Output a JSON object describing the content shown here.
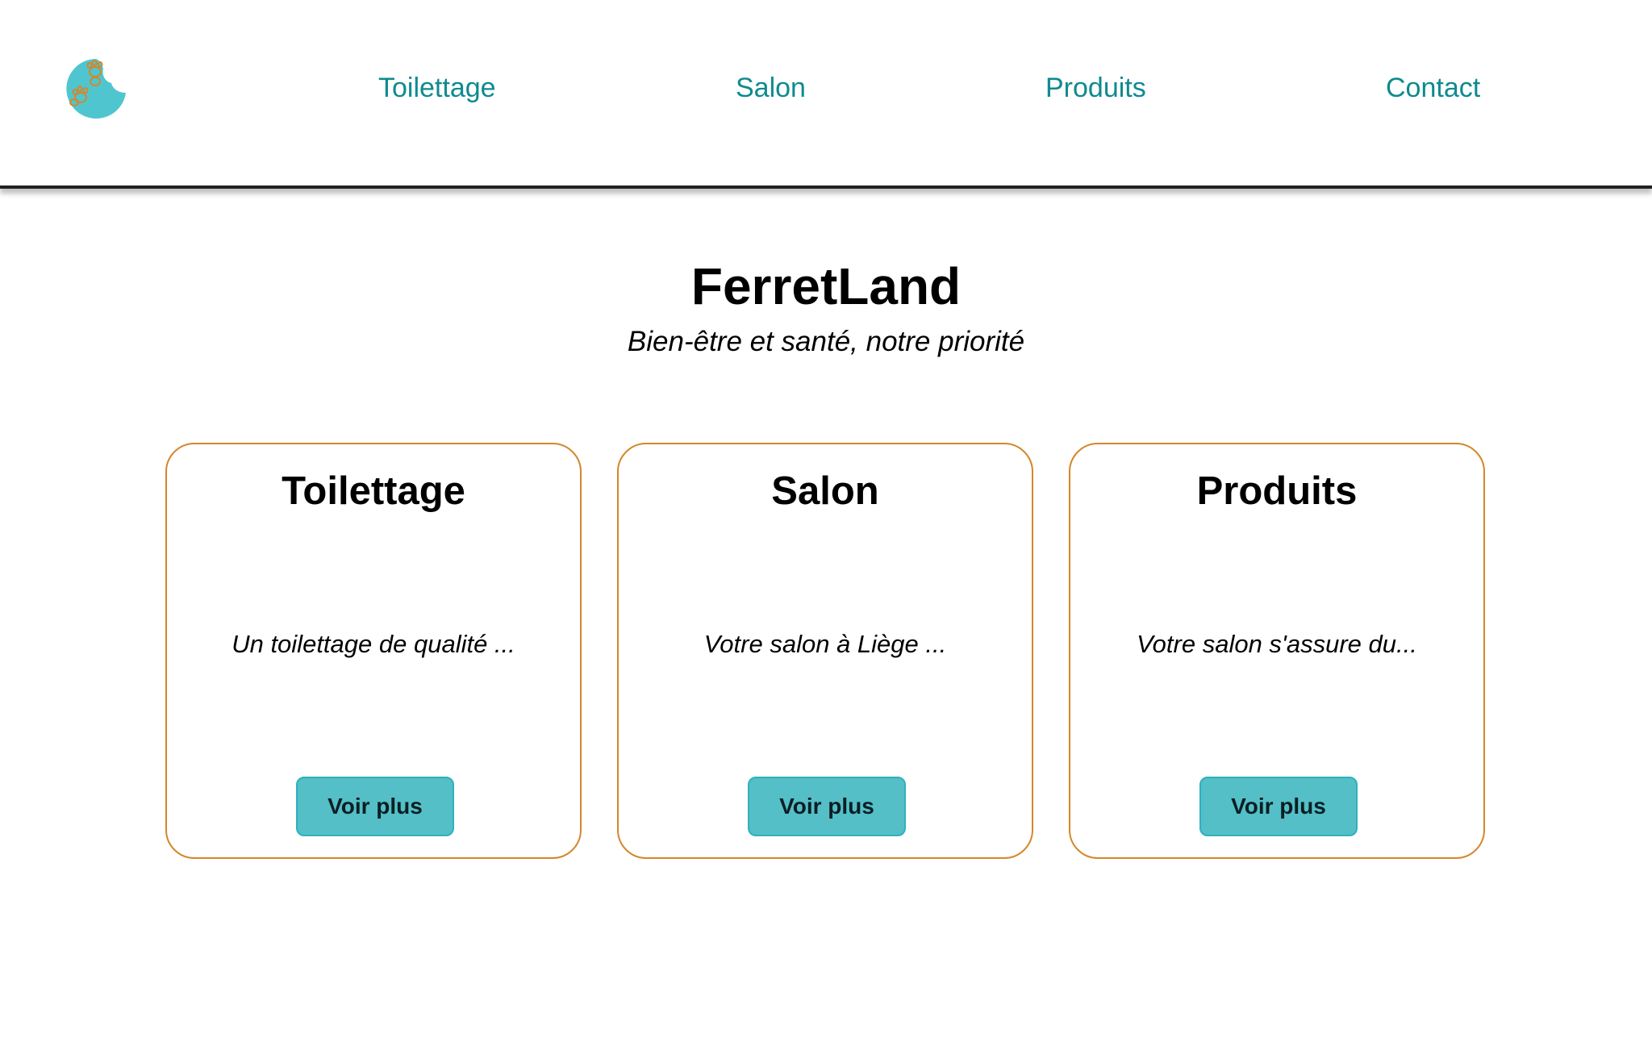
{
  "brand": {
    "logo_icon": "ferret-paw-logo-icon",
    "logo_colors": {
      "circle": "#4fc6cf",
      "paws": "#d4872a"
    }
  },
  "nav": {
    "items": [
      {
        "label": "Toilettage"
      },
      {
        "label": "Salon"
      },
      {
        "label": "Produits"
      },
      {
        "label": "Contact"
      }
    ],
    "color": "#0f8a8e"
  },
  "hero": {
    "title": "FerretLand",
    "subtitle": "Bien-être et santé, notre priorité"
  },
  "cards": [
    {
      "title": "Toilettage",
      "text": "Un toilettage de qualité ...",
      "button": "Voir plus"
    },
    {
      "title": "Salon",
      "text": "Votre salon à Liège ...",
      "button": "Voir plus"
    },
    {
      "title": "Produits",
      "text": "Votre salon s'assure du...",
      "button": "Voir plus"
    }
  ],
  "colors": {
    "card_border": "#d4872a",
    "button_bg": "#54bfc6",
    "button_border": "#2fb1bd"
  }
}
